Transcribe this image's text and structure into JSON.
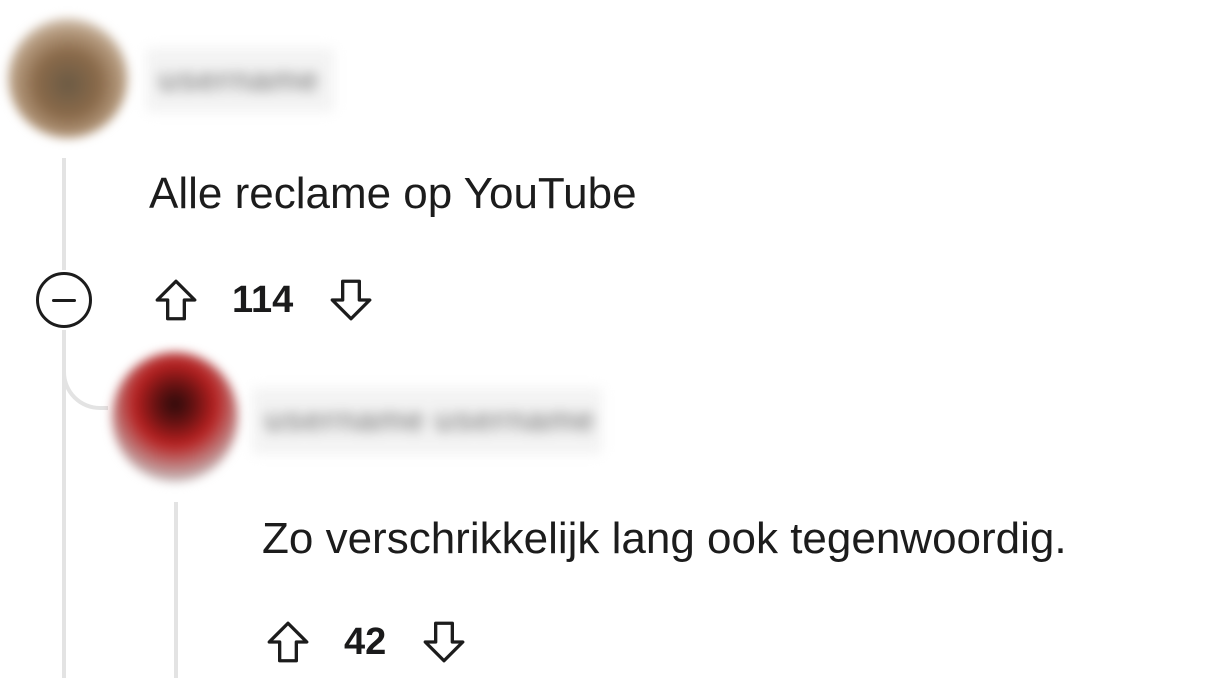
{
  "comments": [
    {
      "author": "username",
      "text": "Alle reclame op YouTube",
      "score": "114",
      "upvote_icon": "arrow-up-outline",
      "downvote_icon": "arrow-down-outline",
      "collapse_icon": "minus-circle"
    },
    {
      "author": "username username",
      "text": "Zo verschrikkelijk lang ook tegenwoordig.",
      "score": "42",
      "upvote_icon": "arrow-up-outline",
      "downvote_icon": "arrow-down-outline"
    }
  ],
  "colors": {
    "text": "#1c1c1c",
    "thread_line": "#e3e3e3",
    "background": "#ffffff"
  }
}
